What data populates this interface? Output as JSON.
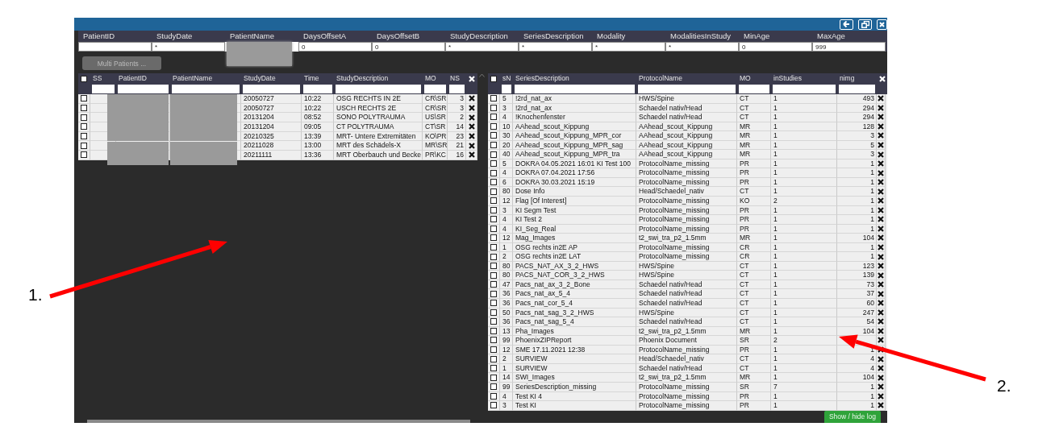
{
  "filters": [
    {
      "label": "PatientID"
    },
    {
      "label": "StudyDate",
      "value": "*"
    },
    {
      "label": "PatientName",
      "redacted": true
    },
    {
      "label": "DaysOffsetA",
      "value": "0"
    },
    {
      "label": "DaysOffsetB",
      "value": "0"
    },
    {
      "label": "StudyDescription",
      "value": "*"
    },
    {
      "label": "SeriesDescription",
      "value": "*"
    },
    {
      "label": "Modality",
      "value": "*"
    },
    {
      "label": "ModalitiesInStudy",
      "value": "*"
    },
    {
      "label": "MinAge",
      "value": "0"
    },
    {
      "label": "MaxAge",
      "value": "999"
    }
  ],
  "multi_patients_button": {
    "label": "Multi Patients ...",
    "disabled": true
  },
  "studies": {
    "select_all": {
      "checked": false
    },
    "columns": [
      "SS",
      "PatientID",
      "PatientName",
      "StudyDate",
      "Time",
      "StudyDescription",
      "MO",
      "NS"
    ],
    "rows": [
      {
        "checked": false,
        "redacted": true,
        "study_date": "20050727",
        "time": "10:22",
        "study_description": "OSG RECHTS IN 2E",
        "mo": "CR\\SR",
        "ns": "3"
      },
      {
        "checked": false,
        "redacted": true,
        "study_date": "20050727",
        "time": "10:22",
        "study_description": "USCH RECHTS 2E",
        "mo": "CR\\SR",
        "ns": "3"
      },
      {
        "checked": false,
        "redacted": true,
        "study_date": "20131204",
        "time": "08:52",
        "study_description": "SONO POLYTRAUMA",
        "mo": "US\\SR",
        "ns": "2"
      },
      {
        "checked": false,
        "redacted": true,
        "study_date": "20131204",
        "time": "09:05",
        "study_description": "CT POLYTRAUMA",
        "mo": "CT\\SR",
        "ns": "14"
      },
      {
        "checked": false,
        "redacted": true,
        "study_date": "20210325",
        "time": "13:39",
        "study_description": "MRT- Untere Extremitäten",
        "mo": "KO\\PR",
        "ns": "23"
      },
      {
        "checked": false,
        "redacted": true,
        "study_date": "20211028",
        "time": "13:00",
        "study_description": "MRT des Schädels-X",
        "mo": "MR\\SR",
        "ns": "21"
      },
      {
        "checked": false,
        "redacted": true,
        "study_date": "20211111",
        "time": "13:36",
        "study_description": "MRT Oberbauch und Becke",
        "mo": "PR\\KC",
        "ns": "16"
      }
    ]
  },
  "series": {
    "select_all": {
      "checked": false
    },
    "columns": [
      "sN",
      "SeriesDescription",
      "ProtocolName",
      "MO",
      "inStudies",
      "nimg"
    ],
    "rows": [
      {
        "checked": false,
        "sn": "5",
        "series_description": "!2rd_nat_ax",
        "protocol_name": "HWS/Spine",
        "mo": "CT",
        "in_studies": "1",
        "nimg": "493"
      },
      {
        "checked": false,
        "sn": "3",
        "series_description": "!2rd_nat_ax",
        "protocol_name": "Schaedel nativ/Head",
        "mo": "CT",
        "in_studies": "1",
        "nimg": "294"
      },
      {
        "checked": false,
        "sn": "4",
        "series_description": "!Knochenfenster",
        "protocol_name": "Schaedel nativ/Head",
        "mo": "CT",
        "in_studies": "1",
        "nimg": "294"
      },
      {
        "checked": false,
        "sn": "10",
        "series_description": "AAhead_scout_Kippung",
        "protocol_name": "AAhead_scout_Kippung",
        "mo": "MR",
        "in_studies": "1",
        "nimg": "128"
      },
      {
        "checked": false,
        "sn": "30",
        "series_description": "AAhead_scout_Kippung_MPR_cor",
        "protocol_name": "AAhead_scout_Kippung",
        "mo": "MR",
        "in_studies": "1",
        "nimg": "3"
      },
      {
        "checked": false,
        "sn": "20",
        "series_description": "AAhead_scout_Kippung_MPR_sag",
        "protocol_name": "AAhead_scout_Kippung",
        "mo": "MR",
        "in_studies": "1",
        "nimg": "5"
      },
      {
        "checked": false,
        "sn": "40",
        "series_description": "AAhead_scout_Kippung_MPR_tra",
        "protocol_name": "AAhead_scout_Kippung",
        "mo": "MR",
        "in_studies": "1",
        "nimg": "3"
      },
      {
        "checked": false,
        "sn": "5",
        "series_description": "DOKRA 04.05.2021 16:01 KI Test 100",
        "protocol_name": "ProtocolName_missing",
        "mo": "PR",
        "in_studies": "1",
        "nimg": "1"
      },
      {
        "checked": false,
        "sn": "4",
        "series_description": "DOKRA 07.04.2021 17:56",
        "protocol_name": "ProtocolName_missing",
        "mo": "PR",
        "in_studies": "1",
        "nimg": "1"
      },
      {
        "checked": false,
        "sn": "6",
        "series_description": "DOKRA 30.03.2021 15:19",
        "protocol_name": "ProtocolName_missing",
        "mo": "PR",
        "in_studies": "1",
        "nimg": "1"
      },
      {
        "checked": false,
        "sn": "80",
        "series_description": "Dose Info",
        "protocol_name": "Head/Schaedel_nativ",
        "mo": "CT",
        "in_studies": "1",
        "nimg": "1"
      },
      {
        "checked": false,
        "sn": "12",
        "series_description": "Flag [Of Interest]",
        "protocol_name": "ProtocolName_missing",
        "mo": "KO",
        "in_studies": "2",
        "nimg": "1"
      },
      {
        "checked": false,
        "sn": "3",
        "series_description": "KI Segm Test",
        "protocol_name": "ProtocolName_missing",
        "mo": "PR",
        "in_studies": "1",
        "nimg": "1"
      },
      {
        "checked": false,
        "sn": "4",
        "series_description": "KI Test 2",
        "protocol_name": "ProtocolName_missing",
        "mo": "PR",
        "in_studies": "1",
        "nimg": "1"
      },
      {
        "checked": false,
        "sn": "4",
        "series_description": "KI_Seg_Real",
        "protocol_name": "ProtocolName_missing",
        "mo": "PR",
        "in_studies": "1",
        "nimg": "1"
      },
      {
        "checked": false,
        "sn": "12",
        "series_description": "Mag_Images",
        "protocol_name": "t2_swi_tra_p2_1.5mm",
        "mo": "MR",
        "in_studies": "1",
        "nimg": "104"
      },
      {
        "checked": false,
        "sn": "1",
        "series_description": "OSG rechts in2E AP",
        "protocol_name": "ProtocolName_missing",
        "mo": "CR",
        "in_studies": "1",
        "nimg": "1"
      },
      {
        "checked": false,
        "sn": "2",
        "series_description": "OSG rechts in2E LAT",
        "protocol_name": "ProtocolName_missing",
        "mo": "CR",
        "in_studies": "1",
        "nimg": "1"
      },
      {
        "checked": false,
        "sn": "80",
        "series_description": "PACS_NAT_AX_3_2_HWS",
        "protocol_name": "HWS/Spine",
        "mo": "CT",
        "in_studies": "1",
        "nimg": "123"
      },
      {
        "checked": false,
        "sn": "80",
        "series_description": "PACS_NAT_COR_3_2_HWS",
        "protocol_name": "HWS/Spine",
        "mo": "CT",
        "in_studies": "1",
        "nimg": "139"
      },
      {
        "checked": false,
        "sn": "47",
        "series_description": "Pacs_nat_ax_3_2_Bone",
        "protocol_name": "Schaedel nativ/Head",
        "mo": "CT",
        "in_studies": "1",
        "nimg": "73"
      },
      {
        "checked": false,
        "sn": "36",
        "series_description": "Pacs_nat_ax_5_4",
        "protocol_name": "Schaedel nativ/Head",
        "mo": "CT",
        "in_studies": "1",
        "nimg": "37"
      },
      {
        "checked": false,
        "sn": "36",
        "series_description": "Pacs_nat_cor_5_4",
        "protocol_name": "Schaedel nativ/Head",
        "mo": "CT",
        "in_studies": "1",
        "nimg": "60"
      },
      {
        "checked": false,
        "sn": "50",
        "series_description": "Pacs_nat_sag_3_2_HWS",
        "protocol_name": "HWS/Spine",
        "mo": "CT",
        "in_studies": "1",
        "nimg": "247"
      },
      {
        "checked": false,
        "sn": "36",
        "series_description": "Pacs_nat_sag_5_4",
        "protocol_name": "Schaedel nativ/Head",
        "mo": "CT",
        "in_studies": "1",
        "nimg": "54"
      },
      {
        "checked": false,
        "sn": "13",
        "series_description": "Pha_Images",
        "protocol_name": "t2_swi_tra_p2_1.5mm",
        "mo": "MR",
        "in_studies": "1",
        "nimg": "104"
      },
      {
        "checked": false,
        "sn": "99",
        "series_description": "PhoenixZIPReport",
        "protocol_name": "Phoenix Document",
        "mo": "SR",
        "in_studies": "2"
      },
      {
        "checked": false,
        "sn": "12",
        "series_description": "SME 17.11.2021 12:38",
        "protocol_name": "ProtocolName_missing",
        "mo": "PR",
        "in_studies": "1",
        "nimg": "1"
      },
      {
        "checked": false,
        "sn": "2",
        "series_description": "SURVIEW",
        "protocol_name": "Head/Schaedel_nativ",
        "mo": "CT",
        "in_studies": "1",
        "nimg": "4"
      },
      {
        "checked": false,
        "sn": "1",
        "series_description": "SURVIEW",
        "protocol_name": "Schaedel nativ/Head",
        "mo": "CT",
        "in_studies": "1",
        "nimg": "4"
      },
      {
        "checked": false,
        "sn": "14",
        "series_description": "SWI_Images",
        "protocol_name": "t2_swi_tra_p2_1.5mm",
        "mo": "MR",
        "in_studies": "1",
        "nimg": "104"
      },
      {
        "checked": false,
        "sn": "99",
        "series_description": "SeriesDescription_missing",
        "protocol_name": "ProtocolName_missing",
        "mo": "SR",
        "in_studies": "7",
        "nimg": "1"
      },
      {
        "checked": false,
        "sn": "4",
        "series_description": "Test KI 4",
        "protocol_name": "ProtocolName_missing",
        "mo": "PR",
        "in_studies": "1",
        "nimg": "1"
      },
      {
        "checked": false,
        "sn": "3",
        "series_description": "Test KI",
        "protocol_name": "ProtocolName_missing",
        "mo": "PR",
        "in_studies": "1",
        "nimg": "1"
      }
    ]
  },
  "log_button": "Show / hide log",
  "annotations": [
    {
      "label": "1."
    },
    {
      "label": "2."
    }
  ]
}
